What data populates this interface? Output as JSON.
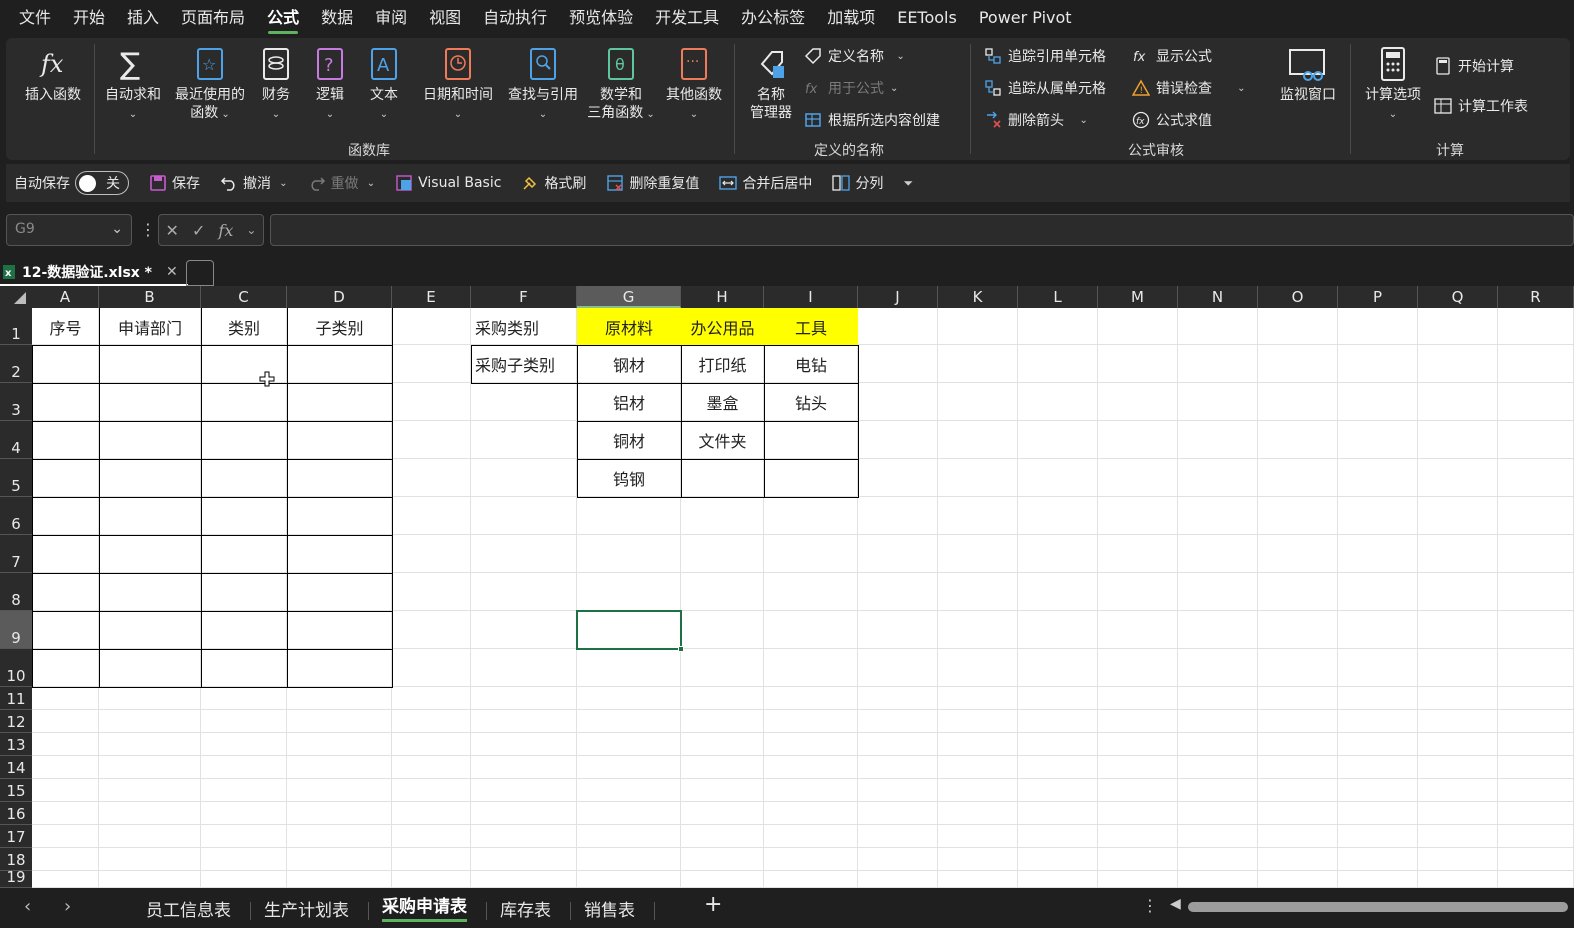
{
  "menu": {
    "items": [
      "文件",
      "开始",
      "插入",
      "页面布局",
      "公式",
      "数据",
      "审阅",
      "视图",
      "自动执行",
      "预览体验",
      "开发工具",
      "办公标签",
      "加载项",
      "EETools",
      "Power Pivot"
    ],
    "active": "公式"
  },
  "ribbon": {
    "insert_function": "插入函数",
    "autosum": "自动求和",
    "recent_1": "最近使用的",
    "recent_2": "函数",
    "financial": "财务",
    "logical": "逻辑",
    "text": "文本",
    "datetime": "日期和时间",
    "lookup": "查找与引用",
    "math_1": "数学和",
    "math_2": "三角函数",
    "more": "其他函数",
    "group_library": "函数库",
    "name_manager_1": "名称",
    "name_manager_2": "管理器",
    "define_name": "定义名称",
    "use_in_formula": "用于公式",
    "create_from_selection": "根据所选内容创建",
    "group_names": "定义的名称",
    "trace_precedents": "追踪引用单元格",
    "trace_dependents": "追踪从属单元格",
    "remove_arrows": "删除箭头",
    "show_formulas": "显示公式",
    "error_checking": "错误检查",
    "evaluate_formula": "公式求值",
    "group_auditing": "公式审核",
    "watch_window": "监视窗口",
    "calc_options": "计算选项",
    "calc_now": "开始计算",
    "calc_sheet": "计算工作表",
    "group_calc": "计算"
  },
  "qat": {
    "autosave": "自动保存",
    "autosave_state": "关",
    "save": "保存",
    "undo": "撤消",
    "redo": "重做",
    "vba": "Visual Basic",
    "format_painter": "格式刷",
    "remove_duplicates": "删除重复值",
    "merge_center": "合并后居中",
    "split": "分列"
  },
  "formula_bar": {
    "name_box": "G9",
    "formula": ""
  },
  "file_tab": {
    "name": "12-数据验证.xlsx *"
  },
  "grid": {
    "columns": [
      "A",
      "B",
      "C",
      "D",
      "E",
      "F",
      "G",
      "H",
      "I",
      "J",
      "K",
      "L",
      "M",
      "N",
      "O",
      "P",
      "Q",
      "R"
    ],
    "rows": [
      "1",
      "2",
      "3",
      "4",
      "5",
      "6",
      "7",
      "8",
      "9",
      "10",
      "11",
      "12",
      "13",
      "14",
      "15",
      "16",
      "17",
      "18",
      "19"
    ],
    "selected_column": "G",
    "selected_row": "9",
    "table_headers": [
      "序号",
      "申请部门",
      "类别",
      "子类别"
    ],
    "purchase_category_label": "采购类别",
    "purchase_subcategory_label": "采购子类别",
    "categories": [
      "原材料",
      "办公用品",
      "工具"
    ],
    "raw_materials": [
      "钢材",
      "铝材",
      "铜材",
      "钨钢"
    ],
    "office_supplies": [
      "打印纸",
      "墨盒",
      "文件夹"
    ],
    "tools": [
      "电钻",
      "钻头"
    ],
    "highlight_color": "#ffff00"
  },
  "sheets": {
    "tabs": [
      "员工信息表",
      "生产计划表",
      "采购申请表",
      "库存表",
      "销售表"
    ],
    "active": "采购申请表",
    "add": "+"
  }
}
